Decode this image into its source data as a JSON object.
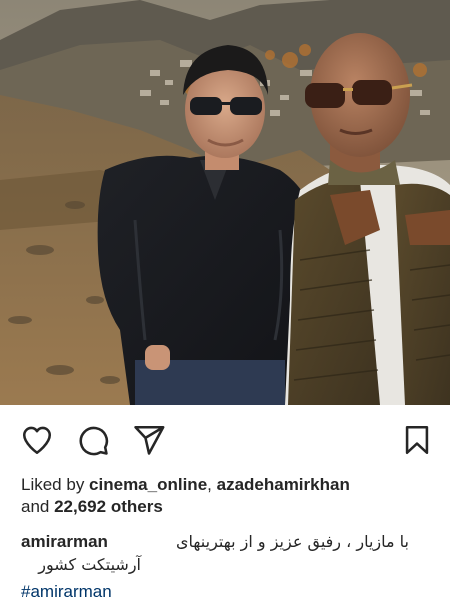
{
  "post": {
    "photo_alt": "selfie",
    "colors": {
      "sky": "#9a8f7e",
      "ground": "#8a6a44",
      "text": "#262626",
      "link": "#003569"
    }
  },
  "actions": {
    "like_icon": "heart-icon",
    "comment_icon": "comment-icon",
    "share_icon": "send-icon",
    "save_icon": "bookmark-icon"
  },
  "likes": {
    "prefix": "Liked by ",
    "user1": "cinema_online",
    "separator": ", ",
    "user2": "azadehamirkhan",
    "and": "and ",
    "others": "22,692 others"
  },
  "caption": {
    "username": "amirarman",
    "text_line1": "با مازیار ، رفیق عزیز و از بهترینهای",
    "text_line2": "آرشیتکت کشور",
    "hashtag": "#amirarman"
  }
}
